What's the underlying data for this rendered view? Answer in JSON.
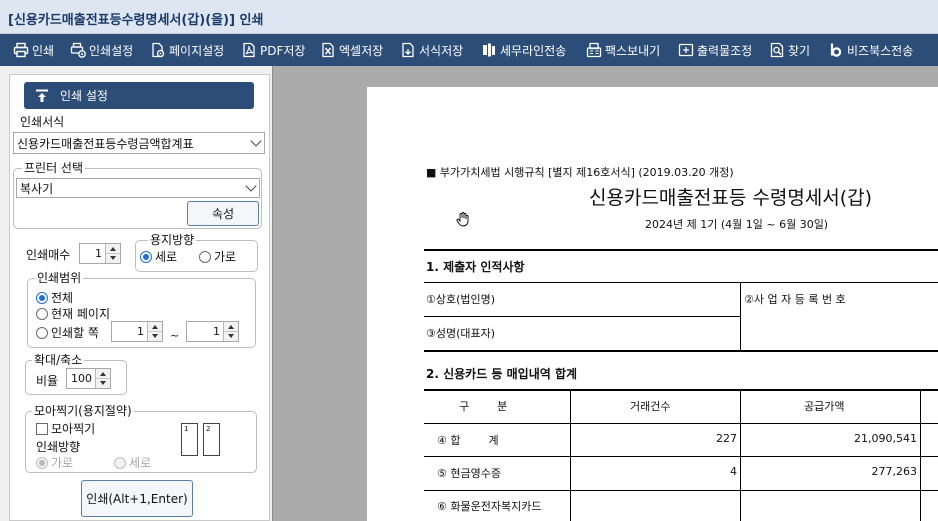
{
  "window": {
    "title": "[신용카드매출전표등수령명세서(갑)(을)] 인쇄"
  },
  "toolbar": {
    "print": "인쇄",
    "print_settings": "인쇄설정",
    "page_settings": "페이지설정",
    "pdf_save": "PDF저장",
    "excel_save": "엑셀저장",
    "form_save": "서식저장",
    "tax_line_send": "세무라인전송",
    "fax_send": "팩스보내기",
    "output_adjust": "출력물조정",
    "find": "찾기",
    "bizbox_send": "비즈북스전송"
  },
  "panel": {
    "header": "인쇄 설정",
    "form_label": "인쇄서식",
    "form_value": "신용카드매출전표등수령금액합계표",
    "printer_group": "프린터 선택",
    "printer_value": "복사기",
    "properties_button": "속성",
    "copies_label": "인쇄매수",
    "copies_value": "1",
    "orientation_group": "용지방향",
    "orientation_portrait": "세로",
    "orientation_landscape": "가로",
    "range_group": "인쇄범위",
    "range_all": "전체",
    "range_current": "현재 페이지",
    "range_pages": "인쇄할 쪽",
    "range_from": "1",
    "range_sep": "~",
    "range_to": "1",
    "zoom_group": "확대/축소",
    "zoom_label": "비율",
    "zoom_value": "100",
    "nup_group": "모아찍기(용지절약)",
    "nup_check": "모아찍기",
    "nup_direction_label": "인쇄방향",
    "nup_landscape": "가로",
    "nup_portrait": "세로",
    "nup_page1": "1",
    "nup_page2": "2",
    "print_button": "인쇄(Alt+1,Enter)"
  },
  "document": {
    "form_note": "■ 부가가치세법 시행규칙 [별지 제16호서식] (2019.03.20 개정)",
    "title": "신용카드매출전표등 수령명세서(갑)",
    "period": "2024년 제 1기 (4월 1일 ~ 6월 30일)",
    "section1": "1. 제출자 인적사항",
    "company_label": "①상호(법인명)",
    "bizno_label": "②사 업 자 등 록 번 호",
    "rep_label": "③성명(대표자)",
    "section2": "2. 신용카드 등 매입내역 합계",
    "col_category": "구        분",
    "col_count": "거래건수",
    "col_supply": "공급가액",
    "rows": [
      {
        "label": "④ 합        계",
        "count": "227",
        "supply": "21,090,541"
      },
      {
        "label": "⑤ 현금영수증",
        "count": "4",
        "supply": "277,263"
      },
      {
        "label": "⑥ 화물운전자복지카드",
        "count": "",
        "supply": ""
      }
    ]
  },
  "colors": {
    "toolbar_bg": "#2d4d79",
    "preview_bg": "#ababab",
    "accent": "#1e6fd1"
  }
}
